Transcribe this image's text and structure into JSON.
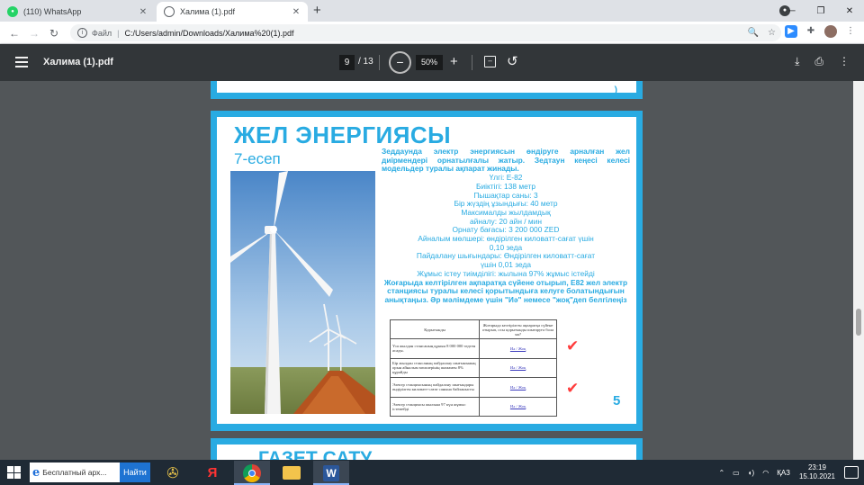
{
  "browser": {
    "tabs": [
      {
        "title": "(110) WhatsApp",
        "favicon": "whatsapp-icon",
        "active": false
      },
      {
        "title": "Халима (1).pdf",
        "favicon": "globe-icon",
        "active": true
      }
    ],
    "new_tab": "+",
    "profile_initial": "●",
    "address": {
      "scheme_label": "Файл",
      "url": "C:/Users/admin/Downloads/Халима%20(1).pdf"
    }
  },
  "pdf_viewer": {
    "title": "Халима (1).pdf",
    "current_page": "9",
    "total_pages": "/ 13",
    "zoom": "50%"
  },
  "page": {
    "heading": "ЖЕЛ ЭНЕРГИЯСЫ",
    "subheading": "7-есеп",
    "intro": "Зеддаунда электр энергиясын өндіруге арналған жел диірмендері орнатылғалы жатыр. Зедтаун кеңесі келесі модельдер туралы ақпарат жинады.",
    "specs": [
      "Үлгі:      Е-82",
      "Биіктігі:   138 метр",
      "Пышақтар саны: 3",
      "Бір жүздің ұзындығы: 40 метр",
      "Максималды жылдамдық",
      "айналу: 20 айн / мин",
      "Орнату бағасы: 3 200 000 ZED",
      "Айналым мөлшері: өндірілген киловатт-сағат үшін",
      "0,10 зеда",
      "Пайдалану шығындары: Өндірілген киловатт-сағат",
      "үшін 0,01 зеда",
      "Жұмыс істеу тиімділігі: жылына 97% жұмыс істейді"
    ],
    "task": "Жоғарыда келтірілген ақпаратқа сүйене отырып, Е82 жел электр станциясы туралы келесі қорытындыға келуге болатындығын анықтаңыз. Әр мәлімдеме үшін \"Иә\" немесе \"жоқ\"деп белгілеңіз",
    "table": {
      "headers": [
        "Қорытынды",
        "Жоғарыда келтірілген ақпаратқа сүйене отырып, осы қорытынды шығаруға бола ма?"
      ],
      "rows": [
        {
          "q": "Үш жылдан стансаның құнын 8 000 000 зедтен асады.",
          "a": "Иә / Жоқ"
        },
        {
          "q": "Бір жылдан стансаның пайдалану шығынының орын айналым мөлшерінің шамамен 8% құрайды",
          "a": "Иә / Жоқ"
        },
        {
          "q": "Электр станциясының пайдалану шығындары өндірілген киловатт-сағат санына байланысты",
          "a": "Иә / Жоқ"
        },
        {
          "q": "Электр станциясы жылына 97 күн жұмыс істемейді",
          "a": "Иә / Жоқ"
        }
      ],
      "check_glyph": "✔"
    },
    "page_number": "5",
    "next_page_heading": "ГАЗЕТ САТУ"
  },
  "taskbar": {
    "search_text": "Бесплатный арх...",
    "search_button": "Найти",
    "apps": [
      "pinwheel-icon",
      "yandex-icon",
      "chrome-icon",
      "file-explorer-icon",
      "word-icon"
    ],
    "yandex_letter": "Я",
    "word_letter": "W",
    "tray": {
      "language": "ҚАЗ",
      "time": "23:19",
      "date": "15.10.2021"
    }
  },
  "colors": {
    "accent": "#29abe2",
    "check": "#ff3b3b",
    "pdf_toolbar": "#323639",
    "doc_bg": "#525659"
  }
}
